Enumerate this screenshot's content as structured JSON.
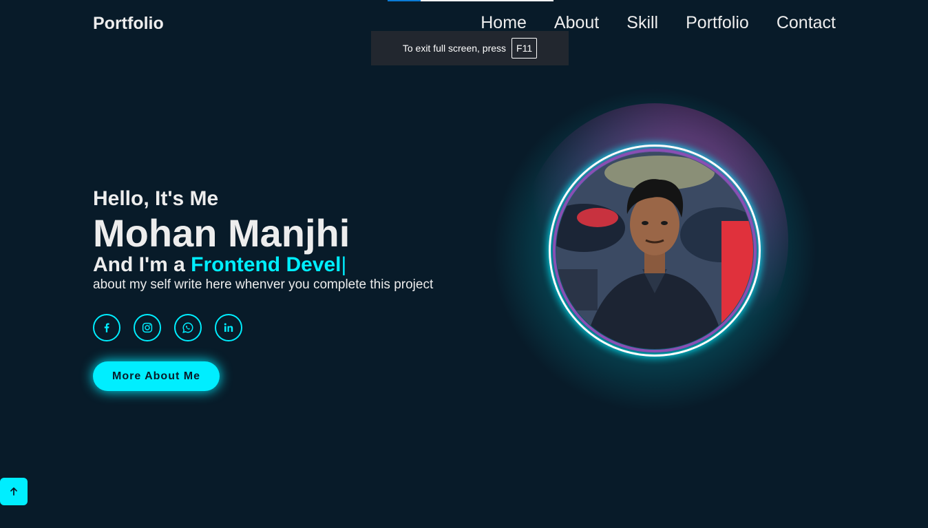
{
  "header": {
    "logo": "Portfolio",
    "nav": [
      "Home",
      "About",
      "Skill",
      "Portfolio",
      "Contact"
    ]
  },
  "toast": {
    "text": "To exit full screen, press",
    "key": "F11"
  },
  "hero": {
    "greeting": "Hello, It's Me",
    "name": "Mohan Manjhi",
    "role_prefix": "And I'm a ",
    "role_typed": "Frontend Devel",
    "caret": "|",
    "description": "about my self write here whenver you complete this project",
    "cta_label": "More About Me"
  },
  "socials": [
    {
      "icon": "facebook-icon"
    },
    {
      "icon": "instagram-icon"
    },
    {
      "icon": "whatsapp-icon"
    },
    {
      "icon": "linkedin-icon"
    }
  ],
  "colors": {
    "background": "#081b29",
    "accent": "#00eeff",
    "text": "#ededed",
    "ring_inner": "#8a4fb3"
  }
}
